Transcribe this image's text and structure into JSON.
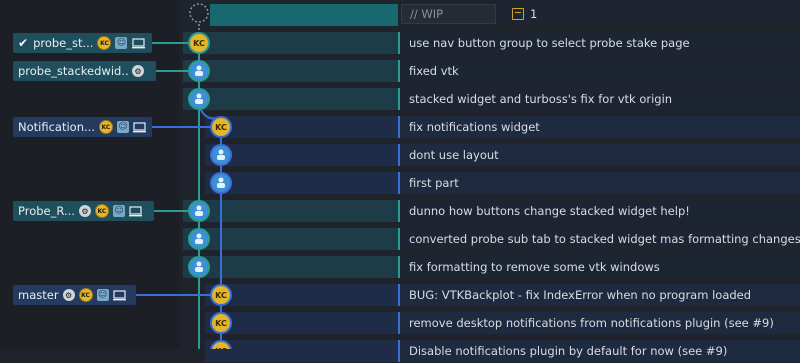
{
  "wip": {
    "placeholder": "// WIP",
    "file_count": "1"
  },
  "branches": [
    {
      "name": "probe_st...",
      "checked": true,
      "style": "cyan",
      "icons": [
        "kc-icon",
        "avatar-icon",
        "computer-icon"
      ]
    },
    {
      "name": "probe_stackedwid...",
      "checked": false,
      "style": "cyan",
      "icons": [
        "github-icon"
      ]
    },
    {
      "name": "Notification...",
      "checked": false,
      "style": "blue",
      "icons": [
        "kc-icon",
        "avatar-icon",
        "computer-icon"
      ]
    },
    {
      "name": "Probe_R...",
      "checked": false,
      "style": "cyan",
      "icons": [
        "github-icon",
        "kc-icon",
        "avatar-icon",
        "computer-icon"
      ]
    },
    {
      "name": "master",
      "checked": false,
      "style": "blue",
      "icons": [
        "github-icon",
        "kc-icon",
        "avatar-icon",
        "computer-icon"
      ]
    }
  ],
  "commits": [
    {
      "message": "use nav button group to select probe stake page"
    },
    {
      "message": "fixed vtk"
    },
    {
      "message": "stacked widget and turboss's fix for vtk origin"
    },
    {
      "message": "fix notifications widget"
    },
    {
      "message": "dont use layout"
    },
    {
      "message": "first part"
    },
    {
      "message": "dunno how buttons change stacked widget help!"
    },
    {
      "message": "converted probe sub tab to stacked widget mas formatting changes"
    },
    {
      "message": "fix formatting to remove some vtk windows"
    },
    {
      "message": "BUG: VTKBackplot - fix IndexError when no program loaded"
    },
    {
      "message": "remove desktop notifications from notifications plugin (see #9)"
    },
    {
      "message": "Disable notifications plugin by default for now (see #9)"
    }
  ],
  "colors": {
    "lane_cyan": "#2a9d8f",
    "lane_blue": "#3a6fd8",
    "header": "#17686f"
  }
}
